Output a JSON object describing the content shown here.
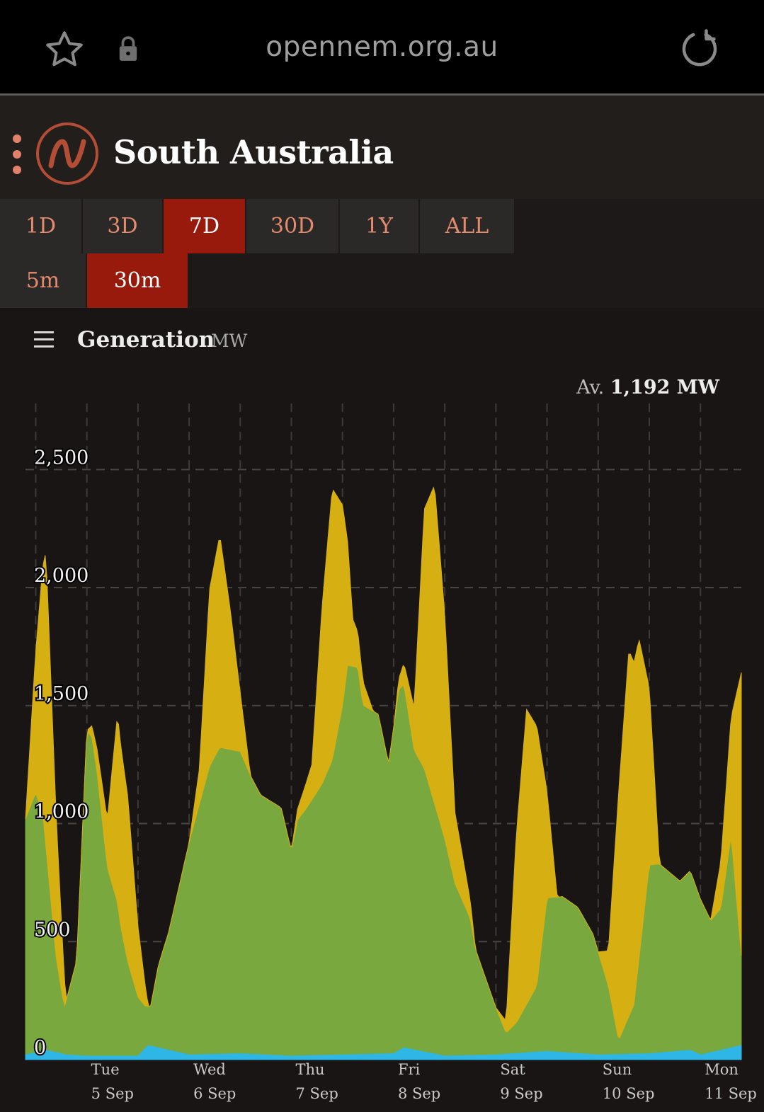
{
  "browser": {
    "url": "opennem.org.au",
    "icons": [
      "star-icon",
      "lock-icon",
      "reload-icon"
    ]
  },
  "header": {
    "title": "South Australia",
    "logo_icon": "opennem-logo-icon",
    "menu_icon": "kebab-menu-icon"
  },
  "range_tabs": [
    {
      "label": "1D",
      "active": false
    },
    {
      "label": "3D",
      "active": false
    },
    {
      "label": "7D",
      "active": true
    },
    {
      "label": "30D",
      "active": false
    },
    {
      "label": "1Y",
      "active": false
    },
    {
      "label": "ALL",
      "active": false
    }
  ],
  "interval_tabs": [
    {
      "label": "5m",
      "active": false
    },
    {
      "label": "30m",
      "active": true
    }
  ],
  "section": {
    "title": "Generation",
    "unit": "MW",
    "avg_prefix": "Av.",
    "avg_value": "1,192 MW"
  },
  "colors": {
    "active_tab": "#971a0c",
    "tab_text": "#e48a6d",
    "wind": "#78a83e",
    "solar": "#d6b012",
    "battery": "#2eb6e6"
  },
  "chart_data": {
    "type": "area",
    "stacked": true,
    "y_ticks": [
      "0",
      "500",
      "1,000",
      "1,500",
      "2,000",
      "2,500"
    ],
    "ylim": [
      0,
      2750
    ],
    "x_ticks": [
      {
        "day": "Tue",
        "date": "5 Sep"
      },
      {
        "day": "Wed",
        "date": "6 Sep"
      },
      {
        "day": "Thu",
        "date": "7 Sep"
      },
      {
        "day": "Fri",
        "date": "8 Sep"
      },
      {
        "day": "Sat",
        "date": "9 Sep"
      },
      {
        "day": "Sun",
        "date": "10 Sep"
      },
      {
        "day": "Mon",
        "date": "11 Sep"
      }
    ],
    "x_days_range": [
      -0.6,
      6.4
    ],
    "grid": true,
    "series": [
      {
        "color": "#2eb6e6",
        "x": [
          -0.6,
          -0.4,
          -0.2,
          0.0,
          0.5,
          0.6,
          1.0,
          1.5,
          2.0,
          2.5,
          3.0,
          3.1,
          3.5,
          4.0,
          4.5,
          5.0,
          5.5,
          5.9,
          6.0,
          6.4
        ],
        "values": [
          20,
          40,
          20,
          15,
          15,
          60,
          20,
          25,
          15,
          20,
          25,
          50,
          15,
          20,
          35,
          20,
          25,
          40,
          20,
          60
        ]
      },
      {
        "color": "#78a83e",
        "x": [
          -0.6,
          -0.5,
          -0.43,
          -0.3,
          -0.22,
          -0.1,
          0.0,
          0.05,
          0.1,
          0.2,
          0.3,
          0.33,
          0.4,
          0.5,
          0.57,
          0.62,
          0.7,
          0.8,
          1.0,
          1.2,
          1.3,
          1.5,
          1.6,
          1.7,
          1.9,
          2.0,
          2.06,
          2.15,
          2.3,
          2.4,
          2.5,
          2.55,
          2.65,
          2.7,
          2.85,
          2.95,
          3.0,
          3.05,
          3.1,
          3.2,
          3.3,
          3.5,
          3.6,
          3.75,
          3.8,
          4.0,
          4.1,
          4.2,
          4.4,
          4.5,
          4.65,
          4.8,
          4.95,
          5.1,
          5.2,
          5.35,
          5.5,
          5.6,
          5.8,
          5.9,
          6.1,
          6.2,
          6.3,
          6.4
        ],
        "values": [
          1000,
          1100,
          1000,
          400,
          200,
          400,
          1380,
          1350,
          1200,
          800,
          650,
          550,
          400,
          250,
          180,
          160,
          350,
          500,
          900,
          1220,
          1300,
          1280,
          1180,
          1100,
          1050,
          870,
          1000,
          1050,
          1150,
          1250,
          1480,
          1650,
          1640,
          1480,
          1440,
          1230,
          1380,
          1530,
          1540,
          1270,
          1200,
          920,
          730,
          580,
          450,
          200,
          90,
          130,
          280,
          650,
          660,
          620,
          510,
          290,
          60,
          210,
          800,
          800,
          720,
          760,
          560,
          600,
          900,
          380
        ]
      },
      {
        "color": "#d6b012",
        "x": [
          -0.6,
          -0.5,
          -0.4,
          -0.3,
          -0.2,
          0.0,
          0.2,
          0.3,
          0.4,
          0.5,
          0.6,
          0.8,
          1.0,
          1.1,
          1.2,
          1.3,
          1.4,
          1.5,
          1.6,
          1.8,
          2.0,
          2.2,
          2.3,
          2.4,
          2.5,
          2.6,
          2.8,
          3.0,
          3.2,
          3.3,
          3.4,
          3.5,
          3.6,
          3.8,
          4.0,
          4.1,
          4.2,
          4.3,
          4.4,
          4.5,
          4.6,
          4.8,
          5.0,
          5.1,
          5.2,
          5.3,
          5.4,
          5.5,
          5.6,
          5.8,
          6.0,
          6.1,
          6.2,
          6.3,
          6.4
        ],
        "values": [
          0,
          600,
          1250,
          600,
          0,
          0,
          200,
          800,
          700,
          300,
          0,
          0,
          0,
          150,
          750,
          900,
          600,
          250,
          0,
          0,
          0,
          150,
          750,
          1150,
          850,
          200,
          0,
          0,
          180,
          1100,
          1350,
          950,
          300,
          0,
          0,
          50,
          800,
          1250,
          1100,
          450,
          0,
          0,
          0,
          150,
          1050,
          1550,
          1350,
          750,
          0,
          0,
          0,
          0,
          200,
          500,
          1200
        ]
      }
    ]
  }
}
